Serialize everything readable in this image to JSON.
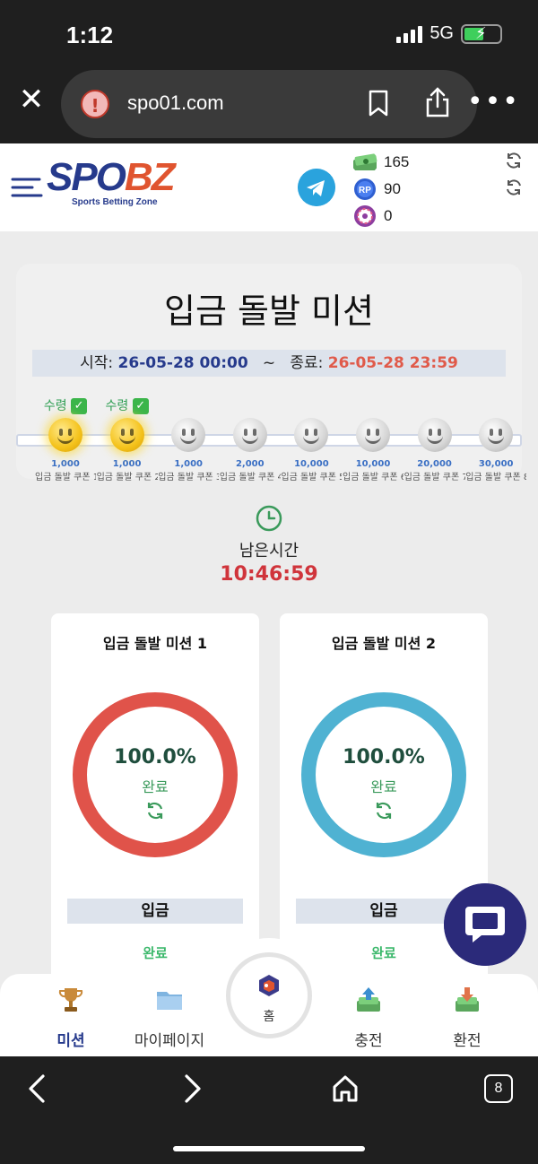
{
  "status_bar": {
    "time": "1:12",
    "network": "5G"
  },
  "browser": {
    "url": "spo01.com",
    "tab_count": "8"
  },
  "header": {
    "logo_part1": "SPO",
    "logo_part2": "BZ",
    "logo_subtitle": "Sports Betting Zone",
    "balances": [
      {
        "icon": "cash-stack-icon",
        "value": "165"
      },
      {
        "icon": "rp-coin-icon",
        "value": "90"
      },
      {
        "icon": "roulette-chip-icon",
        "value": "0"
      }
    ]
  },
  "mission": {
    "title": "입금 돌발 미션",
    "start_label": "시작:",
    "start_value": "26-05-28 00:00",
    "separator": "~",
    "end_label": "종료:",
    "end_value": "26-05-28 23:59",
    "steps": [
      {
        "amount": "1,000",
        "coupon": "입금 돌발 쿠폰 1",
        "received": "수령",
        "state": "received"
      },
      {
        "amount": "1,000",
        "coupon": "입금 돌발 쿠폰 2",
        "received": "수령",
        "state": "received"
      },
      {
        "amount": "1,000",
        "coupon": "입금 돌발 쿠폰 3",
        "received": "",
        "state": "locked"
      },
      {
        "amount": "2,000",
        "coupon": "입금 돌발 쿠폰 4",
        "received": "",
        "state": "locked"
      },
      {
        "amount": "10,000",
        "coupon": "입금 돌발 쿠폰 5",
        "received": "",
        "state": "locked"
      },
      {
        "amount": "10,000",
        "coupon": "입금 돌발 쿠폰 6",
        "received": "",
        "state": "locked"
      },
      {
        "amount": "20,000",
        "coupon": "입금 돌발 쿠폰 7",
        "received": "",
        "state": "locked"
      },
      {
        "amount": "30,000",
        "coupon": "입금 돌발 쿠폰 8",
        "received": "",
        "state": "locked"
      }
    ],
    "remain_label": "남은시간",
    "remain_time": "10:46:59",
    "cards": [
      {
        "title": "입금 돌발 미션 1",
        "percent": "100.0%",
        "status_text": "완료",
        "type": "입금",
        "result": "완료",
        "color": "#e0534a"
      },
      {
        "title": "입금 돌발 미션 2",
        "percent": "100.0%",
        "status_text": "완료",
        "type": "입금",
        "result": "완료",
        "color": "#4fb2d2"
      }
    ]
  },
  "bottom_nav": {
    "items": [
      {
        "label": "미션",
        "icon": "trophy-icon"
      },
      {
        "label": "마이페이지",
        "icon": "folder-icon"
      },
      {
        "label": "홈",
        "icon": "home-logo-icon"
      },
      {
        "label": "충전",
        "icon": "deposit-icon"
      },
      {
        "label": "환전",
        "icon": "withdraw-icon"
      }
    ]
  }
}
